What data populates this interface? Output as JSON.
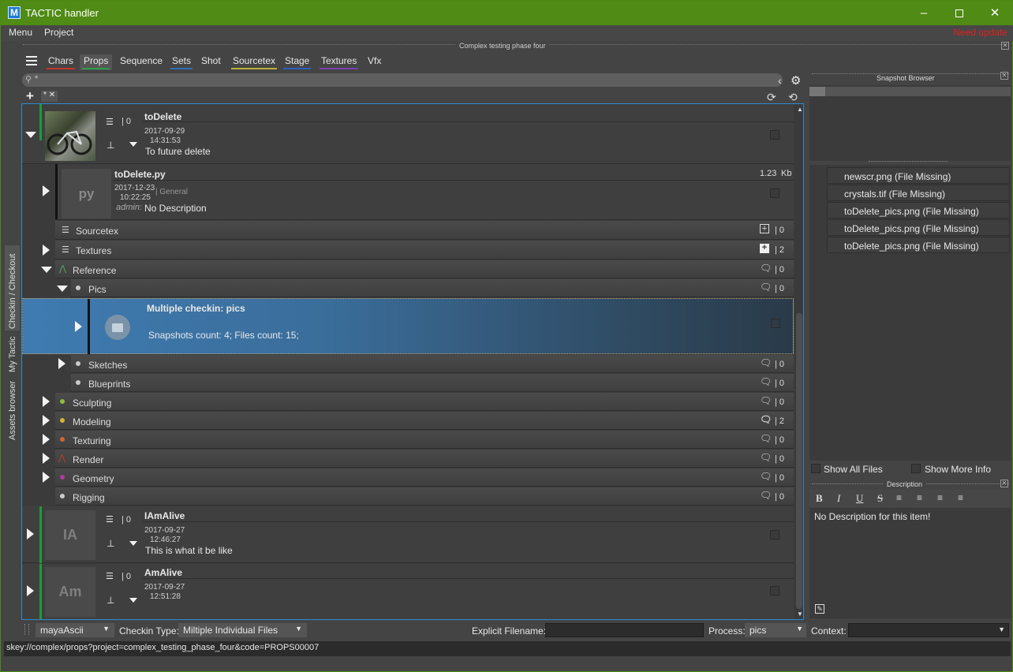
{
  "window": {
    "title": "TACTIC handler",
    "logo": "M",
    "min_icon": "minimize-icon",
    "max_icon": "maximize-icon",
    "close_icon": "close-icon"
  },
  "menu": {
    "items": [
      "Menu",
      "Project"
    ],
    "need_update": "Need update"
  },
  "project_phase": "Complex testing phase four",
  "tabs": [
    {
      "label": "Chars",
      "color": "#c0392b"
    },
    {
      "label": "Props",
      "color": "#2e9e4a"
    },
    {
      "label": "Sequence",
      "color": "#888888"
    },
    {
      "label": "Sets",
      "color": "#2e6fb5"
    },
    {
      "label": "Shot",
      "color": "#888888"
    },
    {
      "label": "Sourcetex",
      "color": "#b8b13a"
    },
    {
      "label": "Stage",
      "color": "#2e5fc0"
    },
    {
      "label": "Textures",
      "color": "#7a3fb0"
    },
    {
      "label": "Vfx",
      "color": "#888888"
    }
  ],
  "search": {
    "placeholder": "*"
  },
  "filter_tab": {
    "label": "*",
    "close": "✕"
  },
  "vertical_tabs": [
    "Checkin / Checkout",
    "My Tactic",
    "Assets browser"
  ],
  "tree": {
    "item1": {
      "title": "toDelete",
      "notes": "| 0",
      "date": "2017-09-29",
      "time": "14:31:53",
      "description": "To future delete"
    },
    "snapshot1": {
      "title": "toDelete.py",
      "thumb": "py",
      "size": "1.23",
      "unit": "Kb",
      "date": "2017-12-23",
      "time": "10:22:25",
      "context": "General",
      "user": "admin:",
      "description": "No Description"
    },
    "sourcetex": {
      "label": "Sourcetex",
      "count": "| 0"
    },
    "textures": {
      "label": "Textures",
      "count": "| 2"
    },
    "reference": {
      "label": "Reference",
      "count": "| 0"
    },
    "pics": {
      "label": "Pics",
      "count": "| 0"
    },
    "multiple": {
      "title": "Multiple checkin: pics",
      "info": "Snapshots count: 4; Files count: 15;"
    },
    "sketches": {
      "label": "Sketches",
      "count": "| 0"
    },
    "blueprints": {
      "label": "Blueprints",
      "count": "| 0"
    },
    "processes": [
      {
        "label": "Sculpting",
        "count": "| 0",
        "color": "#8bbf3c"
      },
      {
        "label": "Modeling",
        "count": "| 2",
        "color": "#d9b13a"
      },
      {
        "label": "Texturing",
        "count": "| 0",
        "color": "#d0662e"
      },
      {
        "label": "Render",
        "count": "| 0",
        "color": "#c0392b"
      },
      {
        "label": "Geometry",
        "count": "| 0",
        "color": "#b03a9a"
      },
      {
        "label": "Rigging",
        "count": "| 0",
        "color": "#cccccc"
      }
    ],
    "item2": {
      "title": "IAmAlive",
      "thumb": "IA",
      "notes": "| 0",
      "date": "2017-09-27",
      "time": "12:46:27",
      "description": "This is what it be like"
    },
    "item3": {
      "title": "AmAlive",
      "thumb": "Am",
      "notes": "| 0",
      "date": "2017-09-27",
      "time": "12:51:28",
      "description": ""
    }
  },
  "snapshot_browser": {
    "title": "Snapshot Browser"
  },
  "files": [
    "newscr.png (File Missing)",
    "crystals.tif (File Missing)",
    "toDelete_pics.png (File Missing)",
    "toDelete_pics.png (File Missing)",
    "toDelete_pics.png (File Missing)"
  ],
  "options": {
    "show_all": "Show All Files",
    "show_more": "Show More Info"
  },
  "description_panel": {
    "title": "Description",
    "text": "No Description for this item!"
  },
  "bottom": {
    "format": "mayaAscii",
    "checkin_type_label": "Checkin Type:",
    "checkin_type": "Miltiple Individual Files",
    "explicit_label": "Explicit Filename:",
    "process_label": "Process:",
    "process": "pics",
    "context_label": "Context:"
  },
  "status": "skey://complex/props?project=complex_testing_phase_four&code=PROPS00007"
}
